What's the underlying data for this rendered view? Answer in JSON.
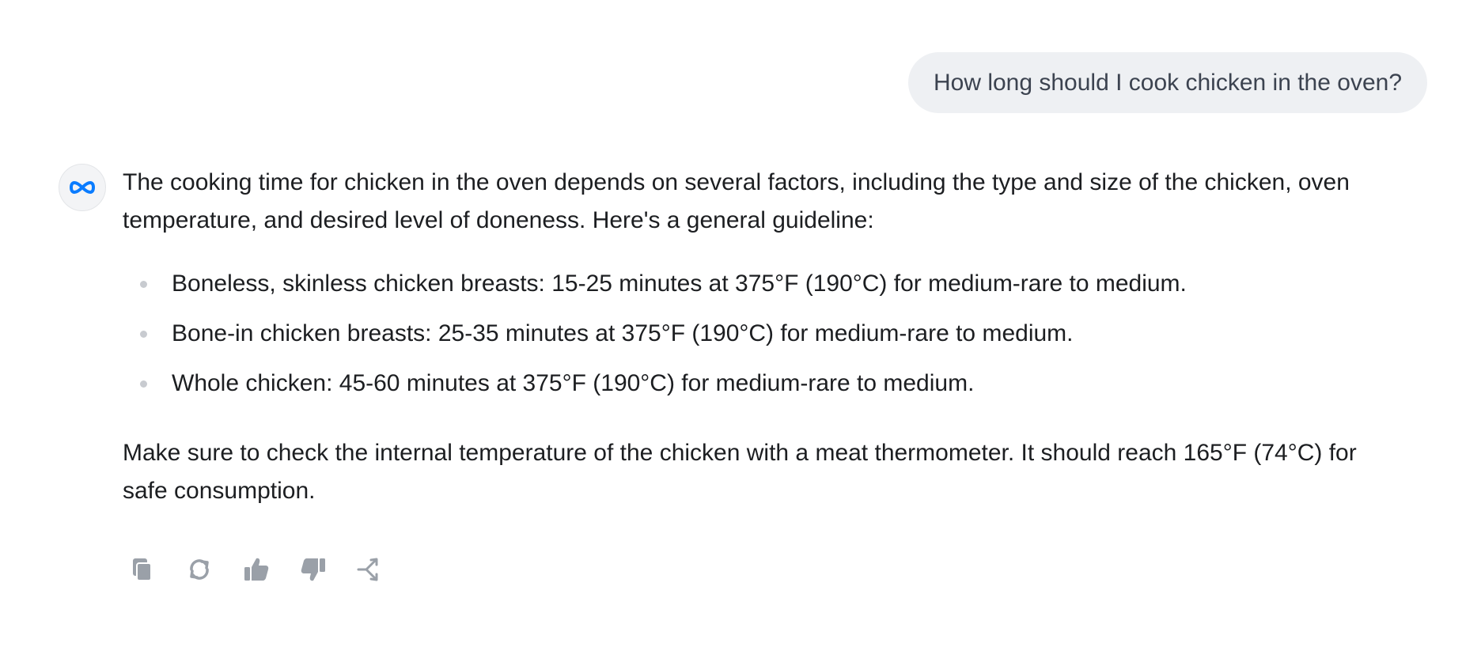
{
  "user_message": "How long should I cook chicken in the oven?",
  "assistant": {
    "avatar_icon": "meta-infinity-logo",
    "intro": "The cooking time for chicken in the oven depends on several factors, including the type and size of the chicken, oven temperature, and desired level of doneness. Here's a general guideline:",
    "bullets": [
      "Boneless, skinless chicken breasts: 15-25 minutes at 375°F (190°C) for medium-rare to medium.",
      "Bone-in chicken breasts: 25-35 minutes at 375°F (190°C) for medium-rare to medium.",
      "Whole chicken: 45-60 minutes at 375°F (190°C) for medium-rare to medium."
    ],
    "closing": "Make sure to check the internal temperature of the chicken with a meat thermometer. It should reach 165°F (74°C) for safe consumption."
  },
  "actions": [
    {
      "icon": "copy-icon"
    },
    {
      "icon": "regenerate-icon"
    },
    {
      "icon": "thumbs-up-icon"
    },
    {
      "icon": "thumbs-down-icon"
    },
    {
      "icon": "share-icon"
    }
  ],
  "colors": {
    "accent": "#0a7cff",
    "icon_gray": "#9aa0a8",
    "bubble_bg": "#eef0f3"
  }
}
